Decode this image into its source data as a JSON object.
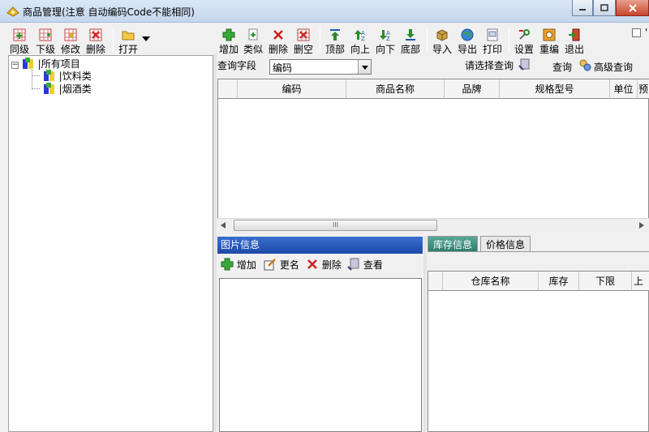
{
  "window": {
    "title": "商品管理(注意 自动编码Code不能相同)"
  },
  "left_toolbar": [
    "同级",
    "下级",
    "修改",
    "删除",
    "打开"
  ],
  "main_toolbar": [
    "增加",
    "类似",
    "删除",
    "删空",
    "顶部",
    "向上",
    "向下",
    "底部",
    "导入",
    "导出",
    "打印",
    "设置",
    "重编",
    "退出"
  ],
  "tree": {
    "root": "|所有项目",
    "children": [
      "|饮料类",
      "|烟酒类"
    ]
  },
  "query": {
    "field_label": "查询字段",
    "field_value": "编码",
    "select_prompt": "请选择查询",
    "search_label": "查询",
    "advanced_label": "高级查询"
  },
  "grid": {
    "columns": [
      "编码",
      "商品名称",
      "品牌",
      "规格型号",
      "单位",
      "预"
    ]
  },
  "scrollbar_grip": "III",
  "picture_panel": {
    "title": "图片信息",
    "actions": [
      "增加",
      "更名",
      "删除",
      "查看"
    ]
  },
  "tabs": [
    "库存信息",
    "价格信息"
  ],
  "stock_grid": {
    "columns": [
      "仓库名称",
      "库存",
      "下限",
      "上"
    ]
  }
}
